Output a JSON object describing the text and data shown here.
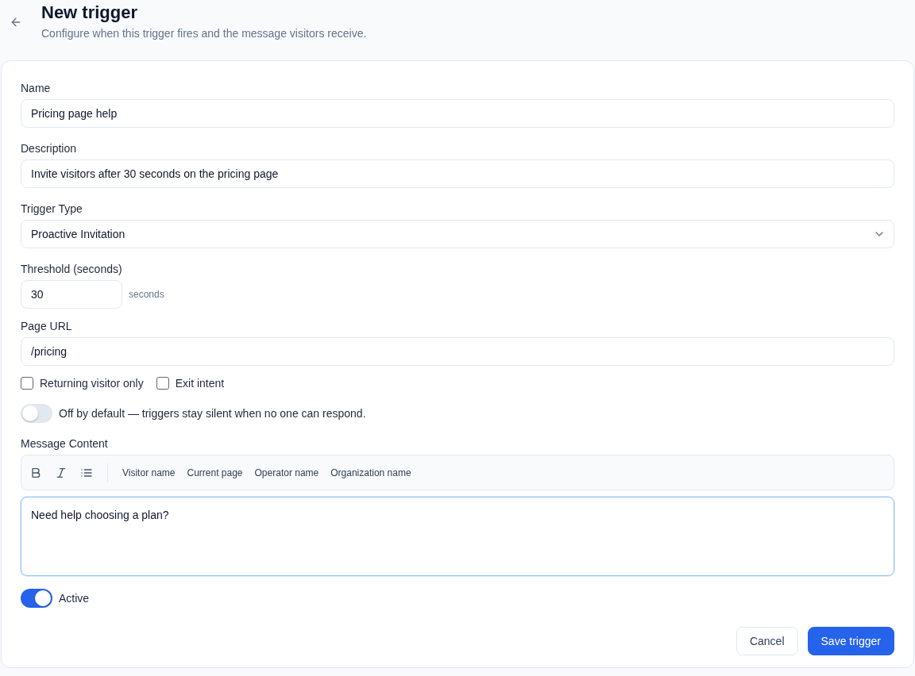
{
  "header": {
    "title": "New trigger",
    "subtitle": "Configure when this trigger fires and the message visitors receive."
  },
  "form": {
    "fields": [
      {
        "kind": "text",
        "label": "Name",
        "value": "Pricing page help"
      },
      {
        "kind": "text",
        "label": "Description",
        "value": "Invite visitors after 30 seconds on the pricing page"
      },
      {
        "kind": "select",
        "label": "Trigger Type",
        "value": "Proactive Invitation"
      },
      {
        "kind": "number",
        "label": "Threshold (seconds)",
        "value": "30",
        "unit": "seconds"
      },
      {
        "kind": "text",
        "label": "Page URL",
        "value": "/pricing"
      }
    ],
    "checkboxes": [
      {
        "label": "Returning visitor only",
        "checked": false
      },
      {
        "label": "Exit intent",
        "checked": false
      }
    ],
    "offline_toggle": {
      "label": "Off by default — triggers stay silent when no one can respond.",
      "on": false
    },
    "message": {
      "label": "Message Content",
      "format_buttons": [
        {
          "kind": "bold"
        },
        {
          "kind": "italic"
        },
        {
          "kind": "list"
        }
      ],
      "variables": [
        "Visitor name",
        "Current page",
        "Operator name",
        "Organization name"
      ],
      "value": "Need help choosing a plan?",
      "focused": true
    },
    "active_toggle": {
      "label": "Active",
      "on": true
    },
    "buttons": [
      {
        "kind": "secondary",
        "label": "Cancel"
      },
      {
        "kind": "primary",
        "label": "Save trigger"
      }
    ]
  }
}
